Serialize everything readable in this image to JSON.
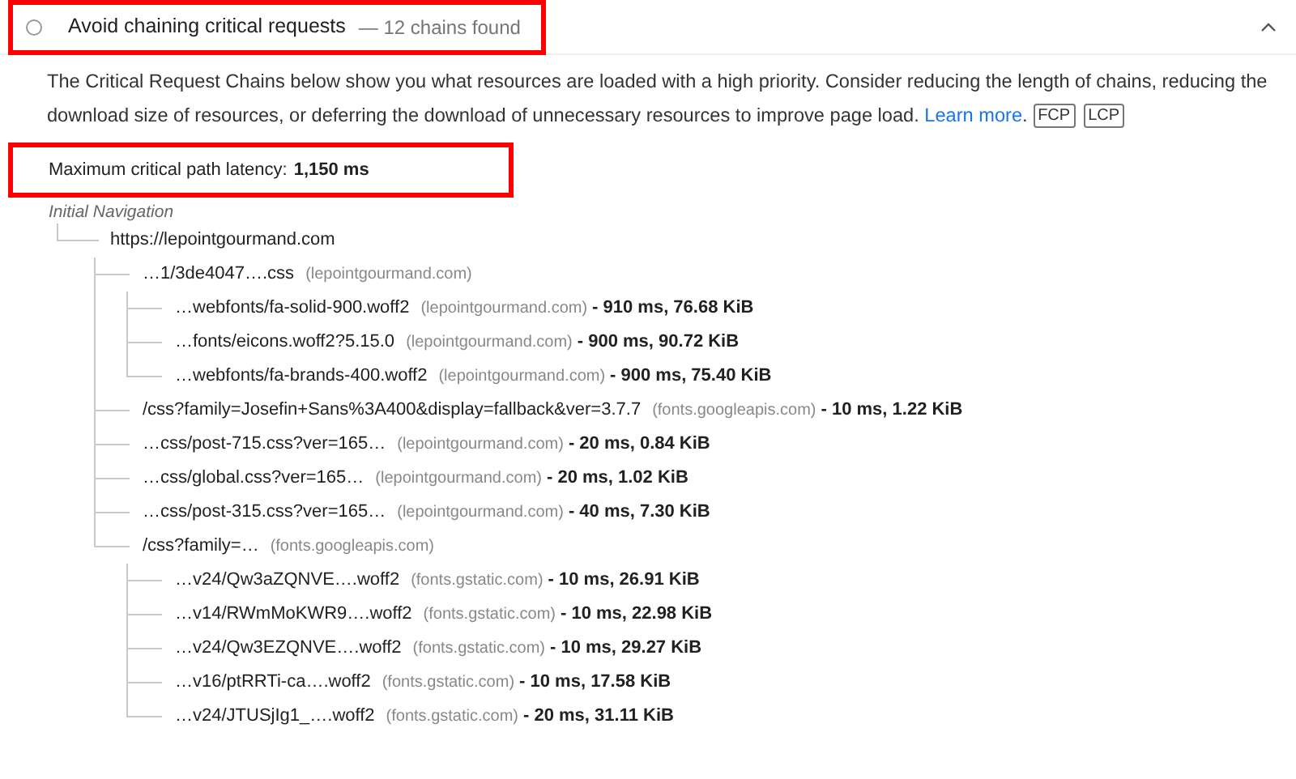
{
  "audit": {
    "title": "Avoid chaining critical requests",
    "summary": "— 12 chains found",
    "expanded": true,
    "description": "The Critical Request Chains below show you what resources are loaded with a high priority. Consider reducing the length of chains, reducing the download size of resources, or deferring the download of unnecessary resources to improve page load.",
    "link": "Learn more",
    "link_after": ".",
    "tags": [
      "FCP",
      "LCP"
    ]
  },
  "latency": {
    "label": "Maximum critical path latency:",
    "value": "1,150 ms"
  },
  "tree": {
    "heading": "Initial Navigation",
    "root": {
      "url": "https://lepointgourmand.com",
      "children": [
        {
          "url": "…1/3de4047….css",
          "host": "(lepointgourmand.com)",
          "children": [
            {
              "url": "…webfonts/fa-solid-900.woff2",
              "host": "(lepointgourmand.com)",
              "stats": "- 910 ms, 76.68 KiB"
            },
            {
              "url": "…fonts/eicons.woff2?5.15.0",
              "host": "(lepointgourmand.com)",
              "stats": "- 900 ms, 90.72 KiB"
            },
            {
              "url": "…webfonts/fa-brands-400.woff2",
              "host": "(lepointgourmand.com)",
              "stats": "- 900 ms, 75.40 KiB"
            }
          ]
        },
        {
          "url": "/css?family=Josefin+Sans%3A400&display=fallback&ver=3.7.7",
          "host": "(fonts.googleapis.com)",
          "stats": "- 10 ms, 1.22 KiB"
        },
        {
          "url": "…css/post-715.css?ver=165…",
          "host": "(lepointgourmand.com)",
          "stats": "- 20 ms, 0.84 KiB"
        },
        {
          "url": "…css/global.css?ver=165…",
          "host": "(lepointgourmand.com)",
          "stats": "- 20 ms, 1.02 KiB"
        },
        {
          "url": "…css/post-315.css?ver=165…",
          "host": "(lepointgourmand.com)",
          "stats": "- 40 ms, 7.30 KiB"
        },
        {
          "url": "/css?family=…",
          "host": "(fonts.googleapis.com)",
          "children": [
            {
              "url": "…v24/Qw3aZQNVE….woff2",
              "host": "(fonts.gstatic.com)",
              "stats": "- 10 ms, 26.91 KiB"
            },
            {
              "url": "…v14/RWmMoKWR9….woff2",
              "host": "(fonts.gstatic.com)",
              "stats": "- 10 ms, 22.98 KiB"
            },
            {
              "url": "…v24/Qw3EZQNVE….woff2",
              "host": "(fonts.gstatic.com)",
              "stats": "- 10 ms, 29.27 KiB"
            },
            {
              "url": "…v16/ptRRTi-ca….woff2",
              "host": "(fonts.gstatic.com)",
              "stats": "- 10 ms, 17.58 KiB"
            },
            {
              "url": "…v24/JTUSjIg1_….woff2",
              "host": "(fonts.gstatic.com)",
              "stats": "- 20 ms, 31.11 KiB"
            }
          ]
        }
      ]
    }
  }
}
